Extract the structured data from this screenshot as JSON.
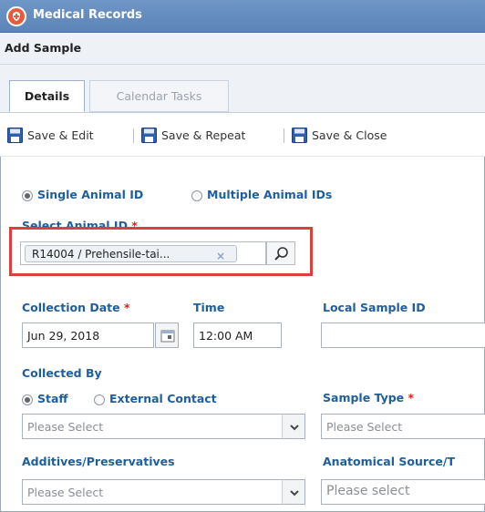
{
  "window": {
    "title": "Medical Records",
    "subtitle": "Add Sample"
  },
  "tabs": [
    {
      "label": "Details",
      "active": true
    },
    {
      "label": "Calendar Tasks",
      "active": false
    }
  ],
  "toolbar": {
    "save_edit": "Save & Edit",
    "save_repeat": "Save & Repeat",
    "save_close": "Save & Close",
    "separator": "|"
  },
  "animal_mode": {
    "single": "Single Animal ID",
    "multiple": "Multiple Animal IDs",
    "selected": "single"
  },
  "select_animal": {
    "label": "Select Animal ID",
    "required_mark": "*",
    "value": "R14004 / Prehensile-tai...",
    "remove": "×"
  },
  "collection_date": {
    "label": "Collection Date",
    "required_mark": "*",
    "value": "Jun 29, 2018"
  },
  "time": {
    "label": "Time",
    "value": "12:00 AM"
  },
  "local_sample_id": {
    "label": "Local Sample ID",
    "value": ""
  },
  "collected_by": {
    "label": "Collected By",
    "staff": "Staff",
    "external": "External Contact",
    "selected": "staff",
    "placeholder": "Please Select"
  },
  "sample_type": {
    "label": "Sample Type",
    "required_mark": "*",
    "placeholder": "Please Select"
  },
  "additives": {
    "label": "Additives/Preservatives",
    "placeholder": "Please Select"
  },
  "anatomical": {
    "label": "Anatomical Source/T",
    "placeholder": "Please select"
  },
  "colors": {
    "accent": "#1f5e9c",
    "highlight": "#d9413c",
    "titlebar": "#6a90c2"
  }
}
